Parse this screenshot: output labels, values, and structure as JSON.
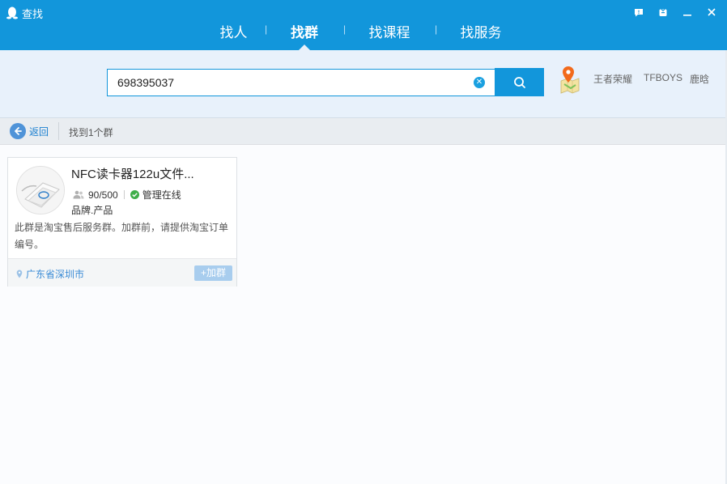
{
  "window": {
    "title": "查找"
  },
  "nav": {
    "tabs": [
      {
        "label": "找人",
        "active": false
      },
      {
        "label": "找群",
        "active": true
      },
      {
        "label": "找课程",
        "active": false
      },
      {
        "label": "找服务",
        "active": false
      }
    ]
  },
  "search": {
    "value": "698395037"
  },
  "hot_tags": [
    "王者荣耀",
    "TFBOYS",
    "鹿晗"
  ],
  "results": {
    "back_label": "返回",
    "count_text": "找到1个群"
  },
  "group": {
    "name": "NFC读卡器122u文件...",
    "members": "90/500",
    "admin_status": "管理在线",
    "tags": "品牌.产品",
    "description": "此群是淘宝售后服务群。加群前，请提供淘宝订单编号。",
    "location": "广东省深圳市",
    "join_label": "+加群"
  },
  "colors": {
    "brand": "#1296db",
    "link": "#3b8cd6",
    "online": "#3fae49"
  }
}
